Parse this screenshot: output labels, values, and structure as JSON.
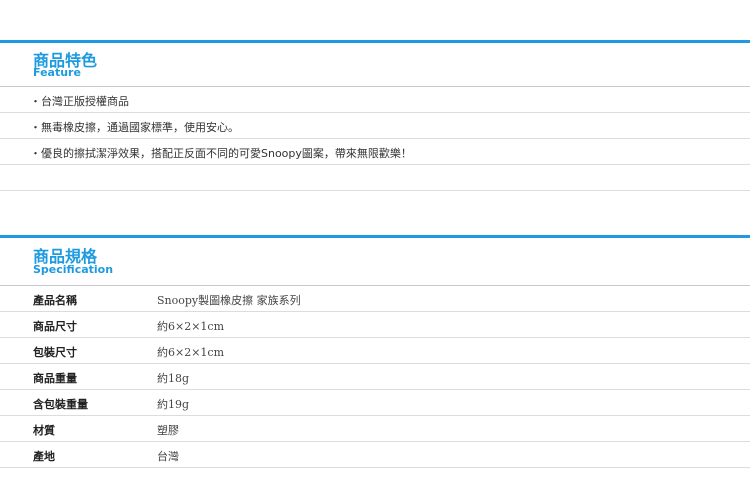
{
  "feature": {
    "title_zh": "商品特色",
    "title_en": "Feature",
    "items": [
      "・台灣正版授權商品",
      "・無毒橡皮擦，通過國家標準，使用安心。",
      "・優良的擦拭潔淨效果，搭配正反面不同的可愛Snoopy圖案，帶來無限歡樂！"
    ]
  },
  "spec": {
    "title_zh": "商品規格",
    "title_en": "Specification",
    "rows": [
      {
        "label": "產品名稱",
        "value": "Snoopy製圖橡皮擦 家族系列"
      },
      {
        "label": "商品尺寸",
        "value": "約6×2×1cm"
      },
      {
        "label": "包裝尺寸",
        "value": "約6×2×1cm"
      },
      {
        "label": "商品重量",
        "value": "約18g"
      },
      {
        "label": "含包裝重量",
        "value": "約19g"
      },
      {
        "label": "材質",
        "value": "塑膠"
      },
      {
        "label": "產地",
        "value": "台灣"
      }
    ]
  }
}
